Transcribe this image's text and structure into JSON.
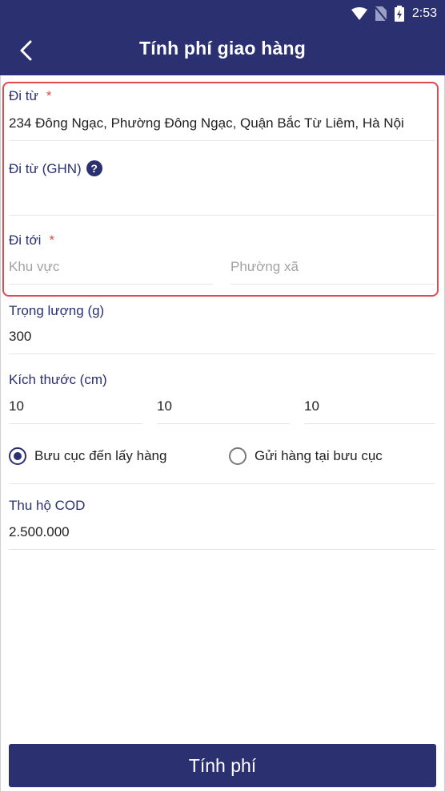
{
  "status_bar": {
    "time": "2:53"
  },
  "header": {
    "title": "Tính phí giao hàng"
  },
  "from": {
    "label": "Đi từ",
    "required_mark": "*",
    "value": "234 Đông Ngạc, Phường Đông Ngạc, Quận Bắc Từ Liêm, Hà Nội"
  },
  "from_ghn": {
    "label": "Đi từ (GHN)",
    "help": "?",
    "value": ""
  },
  "to": {
    "label": "Đi tới",
    "required_mark": "*",
    "area_placeholder": "Khu vực",
    "ward_placeholder": "Phường xã"
  },
  "weight": {
    "label": "Trọng lượng (g)",
    "value": "300"
  },
  "size": {
    "label": "Kích thước (cm)",
    "length": "10",
    "width": "10",
    "height": "10"
  },
  "pickup_option": {
    "options": [
      "Bưu cục đến lấy hàng",
      "Gửi hàng tại bưu cục"
    ],
    "selected": "Bưu cục đến lấy hàng"
  },
  "cod": {
    "label": "Thu hộ COD",
    "value": "2.500.000"
  },
  "submit": {
    "label": "Tính phí"
  },
  "colors": {
    "primary": "#2b3070",
    "required": "#e04a4a",
    "highlight_border": "#e04a4a"
  }
}
